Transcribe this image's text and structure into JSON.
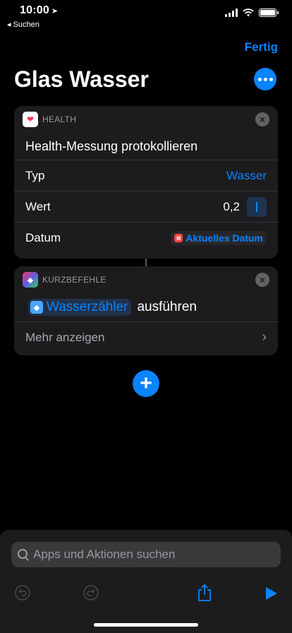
{
  "status_bar": {
    "time": "10:00",
    "back_label": "◂ Suchen"
  },
  "header": {
    "done_label": "Fertig",
    "title": "Glas Wasser"
  },
  "health_action": {
    "app_label": "HEALTH",
    "title": "Health-Messung protokollieren",
    "rows": [
      {
        "label": "Typ",
        "value": "Wasser"
      },
      {
        "label": "Wert",
        "value": "0,2"
      },
      {
        "label": "Datum",
        "value": "Aktuelles Datum"
      }
    ]
  },
  "shortcuts_action": {
    "app_label": "KURZBEFEHLE",
    "shortcut_name": "Wasserzähler",
    "run_label": "ausführen",
    "more_label": "Mehr anzeigen"
  },
  "search": {
    "placeholder": "Apps und Aktionen suchen"
  },
  "colors": {
    "accent": "#0a84ff",
    "card": "#1c1c1e",
    "background": "#000000"
  },
  "icons": [
    "location-arrow-icon",
    "signal-icon",
    "wifi-icon",
    "battery-icon",
    "ellipsis-icon",
    "heart-icon",
    "close-icon",
    "calendar-icon",
    "shortcuts-icon",
    "chevron-right-icon",
    "plus-icon",
    "search-icon",
    "undo-icon",
    "redo-icon",
    "share-icon",
    "play-icon"
  ]
}
